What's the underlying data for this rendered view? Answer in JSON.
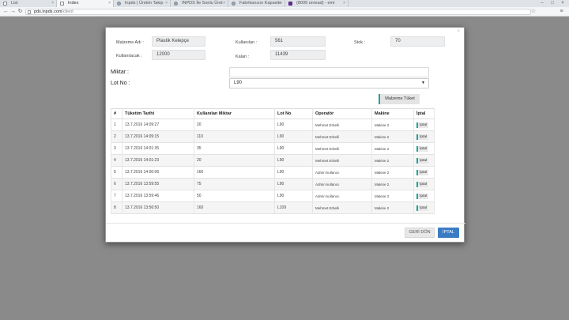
{
  "browser": {
    "tabs": [
      {
        "title": "List",
        "active": false
      },
      {
        "title": "Index",
        "active": true
      },
      {
        "title": "Inpds | Üretim Takip",
        "active": false
      },
      {
        "title": "INPDS İle Sonlu Üret",
        "active": false
      },
      {
        "title": "Fabrikanızın Kapasite",
        "active": false
      },
      {
        "title": "(8009 unread) - emr",
        "active": false
      }
    ],
    "url_host": "pds.inpds.com",
    "url_path": "/client"
  },
  "modal": {
    "close_icon": "×",
    "fields": {
      "malzeme_adi_label": "Malzeme Adı :",
      "malzeme_adi_value": "Plastik Kelepçe",
      "kullanilan_label": "Kullanılan :",
      "kullanilan_value": "561",
      "stok_label": "Stok :",
      "stok_value": "70",
      "kullanilacak_label": "Kullanılacak :",
      "kullanilacak_value": "12000",
      "kalan_label": "Kalan :",
      "kalan_value": "11439"
    },
    "miktar_label": "Miktar :",
    "miktar_value": "",
    "lot_label": "Lot No :",
    "lot_selected": "L90",
    "consume_button": "Malzeme Tüket",
    "table": {
      "headers": [
        "#",
        "Tüketim Tarihi",
        "Kullanılan Miktar",
        "Lot No",
        "Operatör",
        "Makine",
        "İptal"
      ],
      "rows": [
        {
          "no": "1",
          "date": "13.7.2016 14:09:27",
          "qty": "20",
          "lot": "L90",
          "operator": "Mehmet Erbelli",
          "machine": "Makine 2",
          "action": "İptal"
        },
        {
          "no": "2",
          "date": "13.7.2016 14:09:15",
          "qty": "110",
          "lot": "L90",
          "operator": "Mehmet Erbelli",
          "machine": "Makine 2",
          "action": "İptal"
        },
        {
          "no": "3",
          "date": "13.7.2016 14:01:35",
          "qty": "35",
          "lot": "L90",
          "operator": "Mehmet Erbelli",
          "machine": "Makine 2",
          "action": "İptal"
        },
        {
          "no": "4",
          "date": "13.7.2016 14:01:23",
          "qty": "20",
          "lot": "L90",
          "operator": "Mehmet Erbelli",
          "machine": "Makine 2",
          "action": "İptal"
        },
        {
          "no": "5",
          "date": "13.7.2016 14:00:06",
          "qty": "160",
          "lot": "L90",
          "operator": "Admin kullanıcı",
          "machine": "Makine 2",
          "action": "İptal"
        },
        {
          "no": "6",
          "date": "13.7.2016 13:59:55",
          "qty": "75",
          "lot": "L90",
          "operator": "Admin kullanıcı",
          "machine": "Makine 2",
          "action": "İptal"
        },
        {
          "no": "7",
          "date": "13.7.2016 13:59:46",
          "qty": "50",
          "lot": "L90",
          "operator": "Admin kullanıcı",
          "machine": "Makine 2",
          "action": "İptal"
        },
        {
          "no": "8",
          "date": "13.7.2016 13:56:50",
          "qty": "160",
          "lot": "L109",
          "operator": "Mehmet Erbelli",
          "machine": "Makine 2",
          "action": "İptal"
        }
      ]
    },
    "back_button": "GERİ DÖN",
    "cancel_button": "İPTAL"
  },
  "colors": {
    "accent": "#20a59a",
    "primary": "#3a7cc4",
    "overlay": "#8a8a8a"
  }
}
